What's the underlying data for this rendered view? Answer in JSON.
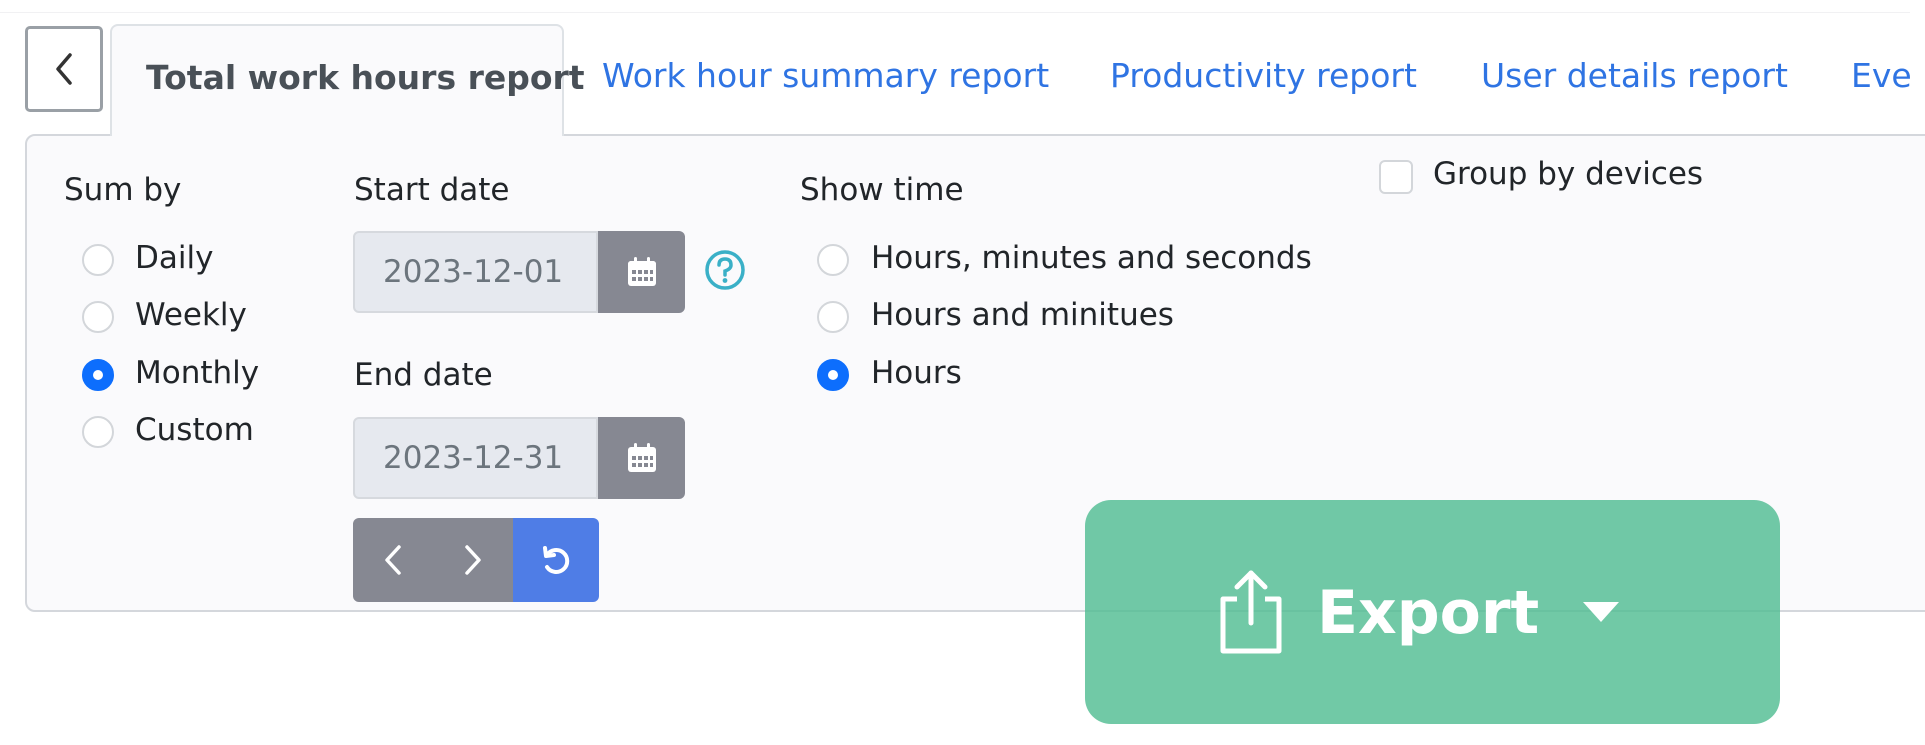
{
  "tabs": {
    "active": "Total work hours report",
    "others": [
      "Work hour summary report",
      "Productivity report",
      "User details report",
      "Eve"
    ]
  },
  "sum_by": {
    "label": "Sum by",
    "options": [
      "Daily",
      "Weekly",
      "Monthly",
      "Custom"
    ],
    "selected": "Monthly"
  },
  "dates": {
    "start_label": "Start date",
    "start_value": "2023-12-01",
    "end_label": "End date",
    "end_value": "2023-12-31"
  },
  "show_time": {
    "label": "Show time",
    "options": [
      "Hours, minutes and seconds",
      "Hours and minitues",
      "Hours"
    ],
    "selected": "Hours"
  },
  "group_by_devices": {
    "label": "Group by devices",
    "checked": false
  },
  "export": {
    "label": "Export"
  },
  "colors": {
    "link": "#2f74e3",
    "radio_checked": "#0d6efd",
    "button_gray": "#868892",
    "button_blue": "#4f7de6",
    "export_green": "#52bd93",
    "help_teal": "#3ab0c7"
  },
  "icons": {
    "back": "chevron-left-icon",
    "calendar": "calendar-icon",
    "help": "question-circle-icon",
    "prev": "chevron-left-icon",
    "next": "chevron-right-icon",
    "reset": "reset-icon",
    "export": "share-upload-icon",
    "dropdown": "caret-down-icon"
  }
}
